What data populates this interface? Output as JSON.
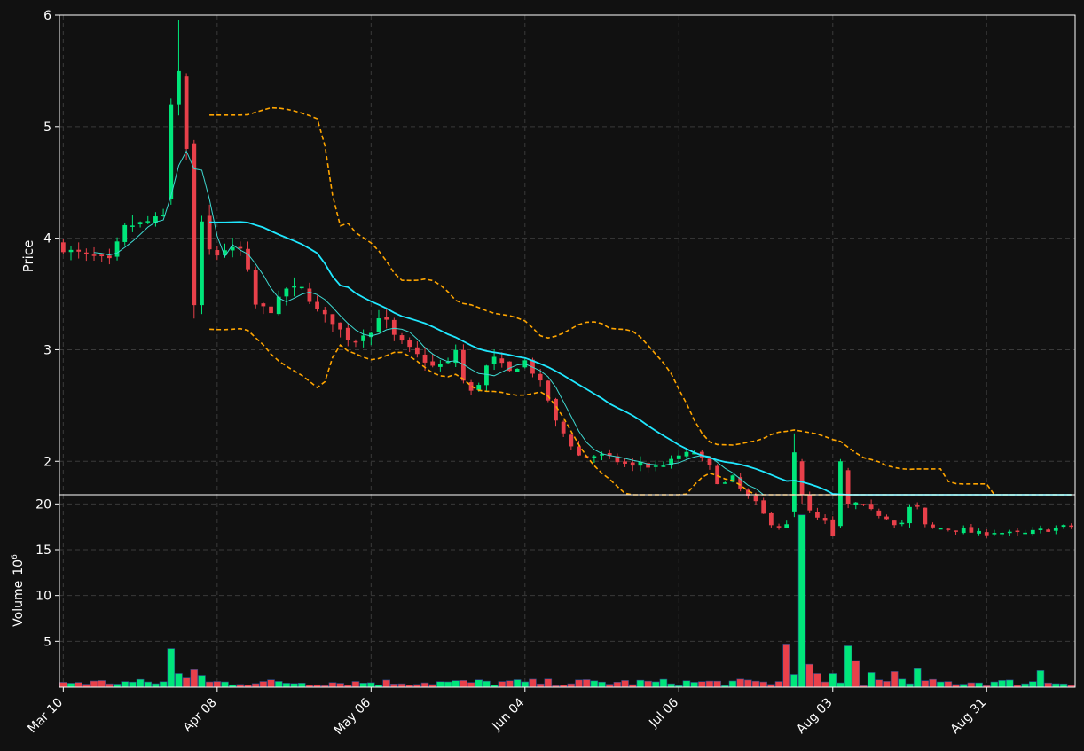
{
  "chart_data": {
    "type": "candlestick",
    "x_tick_labels": [
      "Mar 10",
      "Apr 08",
      "May 06",
      "Jun 04",
      "Jul 06",
      "Aug 03",
      "Aug 31"
    ],
    "price_panel": {
      "ylabel": "Price",
      "ylim": [
        1.7,
        6.0
      ],
      "yticks": [
        2,
        3,
        4,
        5,
        6
      ],
      "grid": true
    },
    "volume_panel": {
      "ylabel": "Volume",
      "unit_exp": "6",
      "ylim": [
        0,
        21
      ],
      "yticks": [
        5,
        10,
        15,
        20
      ],
      "grid": true
    },
    "bar_count": 132,
    "ohlc_anchors": [
      [
        0,
        3.9
      ],
      [
        3,
        3.85
      ],
      [
        6,
        3.8
      ],
      [
        8,
        4.1
      ],
      [
        11,
        4.15
      ],
      [
        13,
        4.2
      ],
      [
        14,
        5.2
      ],
      [
        15,
        5.5
      ],
      [
        16,
        4.9
      ],
      [
        17,
        3.4
      ],
      [
        18,
        4.15
      ],
      [
        19,
        3.9
      ],
      [
        20,
        3.85
      ],
      [
        21,
        3.9
      ],
      [
        23,
        3.9
      ],
      [
        24,
        3.7
      ],
      [
        25,
        3.4
      ],
      [
        27,
        3.35
      ],
      [
        28,
        3.45
      ],
      [
        29,
        3.55
      ],
      [
        31,
        3.55
      ],
      [
        33,
        3.35
      ],
      [
        35,
        3.25
      ],
      [
        37,
        3.1
      ],
      [
        38,
        3.08
      ],
      [
        39,
        3.15
      ],
      [
        40,
        3.15
      ],
      [
        41,
        3.3
      ],
      [
        42,
        3.25
      ],
      [
        43,
        3.12
      ],
      [
        46,
        2.95
      ],
      [
        48,
        2.85
      ],
      [
        50,
        2.88
      ],
      [
        51,
        3.0
      ],
      [
        52,
        2.72
      ],
      [
        53,
        2.62
      ],
      [
        54,
        2.7
      ],
      [
        55,
        2.85
      ],
      [
        56,
        2.92
      ],
      [
        58,
        2.8
      ],
      [
        59,
        2.85
      ],
      [
        60,
        2.9
      ],
      [
        62,
        2.7
      ],
      [
        63,
        2.55
      ],
      [
        64,
        2.35
      ],
      [
        66,
        2.15
      ],
      [
        67,
        2.05
      ],
      [
        68,
        2.05
      ],
      [
        70,
        2.05
      ],
      [
        72,
        2.0
      ],
      [
        74,
        1.95
      ],
      [
        75,
        2.0
      ],
      [
        76,
        1.95
      ],
      [
        77,
        1.95
      ],
      [
        79,
        2.0
      ],
      [
        80,
        2.05
      ],
      [
        82,
        2.08
      ],
      [
        84,
        1.95
      ],
      [
        85,
        1.82
      ],
      [
        86,
        1.8
      ],
      [
        87,
        1.85
      ],
      [
        88,
        1.75
      ],
      [
        89,
        1.68
      ],
      [
        90,
        1.62
      ],
      [
        91,
        1.52
      ],
      [
        92,
        1.45
      ],
      [
        93,
        1.42
      ],
      [
        94,
        1.42
      ],
      [
        95,
        1.8
      ],
      [
        96,
        1.8
      ],
      [
        97,
        1.55
      ],
      [
        98,
        1.48
      ],
      [
        99,
        1.45
      ],
      [
        100,
        1.32
      ],
      [
        101,
        1.92
      ],
      [
        102,
        1.65
      ],
      [
        103,
        1.62
      ],
      [
        105,
        1.55
      ],
      [
        107,
        1.5
      ],
      [
        108,
        1.45
      ],
      [
        109,
        1.45
      ],
      [
        110,
        1.58
      ],
      [
        111,
        1.58
      ],
      [
        112,
        1.42
      ],
      [
        113,
        1.4
      ],
      [
        115,
        1.4
      ],
      [
        117,
        1.38
      ],
      [
        119,
        1.35
      ],
      [
        121,
        1.37
      ],
      [
        123,
        1.35
      ],
      [
        125,
        1.35
      ],
      [
        127,
        1.38
      ],
      [
        129,
        1.4
      ],
      [
        131,
        1.42
      ]
    ],
    "big_candles": [
      {
        "i": 14,
        "open": 4.35,
        "close": 5.2,
        "high": 5.25,
        "low": 4.3
      },
      {
        "i": 15,
        "open": 5.2,
        "close": 5.5,
        "high": 5.96,
        "low": 5.1
      },
      {
        "i": 16,
        "open": 5.45,
        "close": 4.8,
        "high": 5.48,
        "low": 4.7
      },
      {
        "i": 17,
        "open": 4.85,
        "close": 3.4,
        "high": 4.88,
        "low": 3.28
      },
      {
        "i": 18,
        "open": 3.4,
        "close": 4.15,
        "high": 4.2,
        "low": 3.32
      },
      {
        "i": 19,
        "open": 4.2,
        "close": 3.9,
        "high": 4.3,
        "low": 3.85
      },
      {
        "i": 95,
        "open": 1.55,
        "close": 2.08,
        "high": 2.25,
        "low": 1.5
      },
      {
        "i": 96,
        "open": 2.0,
        "close": 1.7,
        "high": 2.02,
        "low": 1.62
      },
      {
        "i": 101,
        "open": 1.42,
        "close": 2.0,
        "high": 2.02,
        "low": 1.4
      },
      {
        "i": 102,
        "open": 1.92,
        "close": 1.62,
        "high": 1.94,
        "low": 1.58
      }
    ],
    "volume_spikes": [
      {
        "i": 14,
        "value": 4.2,
        "up": true
      },
      {
        "i": 15,
        "value": 1.5,
        "up": true
      },
      {
        "i": 16,
        "value": 1.0,
        "up": false
      },
      {
        "i": 17,
        "value": 1.9,
        "up": false
      },
      {
        "i": 18,
        "value": 1.3,
        "up": true
      },
      {
        "i": 94,
        "value": 4.7,
        "up": false
      },
      {
        "i": 95,
        "value": 1.4,
        "up": true
      },
      {
        "i": 96,
        "value": 18.8,
        "up": true
      },
      {
        "i": 97,
        "value": 2.5,
        "up": false
      },
      {
        "i": 98,
        "value": 1.5,
        "up": false
      },
      {
        "i": 100,
        "value": 1.5,
        "up": true
      },
      {
        "i": 102,
        "value": 4.5,
        "up": true
      },
      {
        "i": 103,
        "value": 2.9,
        "up": false
      },
      {
        "i": 105,
        "value": 1.6,
        "up": true
      },
      {
        "i": 108,
        "value": 1.7,
        "up": false
      },
      {
        "i": 111,
        "value": 2.1,
        "up": true
      },
      {
        "i": 127,
        "value": 1.8,
        "up": true
      }
    ],
    "indicators": {
      "ma_short_window": 5,
      "ma_long_window": 20,
      "bollinger_window": 20,
      "bollinger_k": 2
    },
    "colors": {
      "up": "#00e67a",
      "down": "#e8404a",
      "ma_short": "#3ed8d0",
      "ma_long": "#20e8ff",
      "bands": "#ffa500",
      "grid": "#3a3a3a",
      "frame": "#ffffff"
    }
  }
}
